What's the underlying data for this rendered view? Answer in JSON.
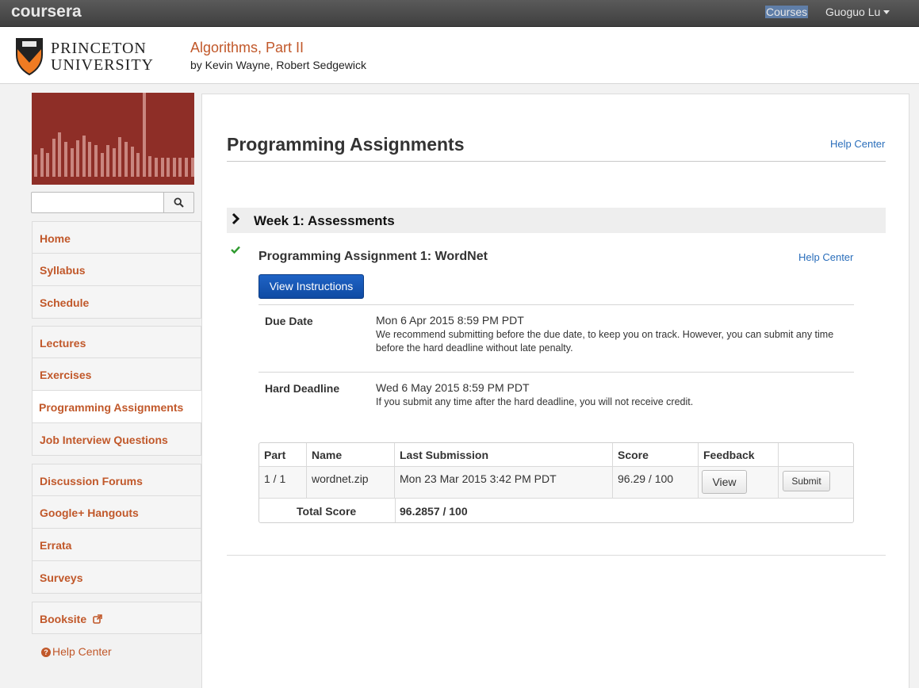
{
  "topbar": {
    "logo": "coursera",
    "courses_label": "Courses",
    "user_name": "Guoguo Lu"
  },
  "header": {
    "university_line1": "PRINCETON",
    "university_line2": "UNIVERSITY",
    "course_title": "Algorithms, Part II",
    "course_authors": "by Kevin Wayne, Robert Sedgewick"
  },
  "sidebar": {
    "group1": [
      "Home",
      "Syllabus",
      "Schedule"
    ],
    "group2": [
      "Lectures",
      "Exercises",
      "Programming Assignments",
      "Job Interview Questions"
    ],
    "group3": [
      "Discussion Forums",
      "Google+ Hangouts",
      "Errata",
      "Surveys"
    ],
    "group4": [
      "Booksite"
    ],
    "active_item": "Programming Assignments",
    "help_label": "Help Center"
  },
  "main": {
    "page_title": "Programming Assignments",
    "help_center_label": "Help Center",
    "week_title": "Week 1: Assessments",
    "assignment": {
      "title": "Programming Assignment 1: WordNet",
      "help_center_label": "Help Center",
      "view_instructions_label": "View Instructions",
      "due_date_label": "Due Date",
      "due_date_value": "Mon 6 Apr 2015 8:59 PM PDT",
      "due_date_note": "We recommend submitting before the due date, to keep you on track. However, you can submit any time before the hard deadline without late penalty.",
      "hard_deadline_label": "Hard Deadline",
      "hard_deadline_value": "Wed 6 May 2015 8:59 PM PDT",
      "hard_deadline_note": "If you submit any time after the hard deadline, you will not receive credit."
    },
    "table": {
      "headers": [
        "Part",
        "Name",
        "Last Submission",
        "Score",
        "Feedback"
      ],
      "row": {
        "part": "1 / 1",
        "name": "wordnet.zip",
        "last_submission": "Mon 23 Mar 2015 3:42 PM PDT",
        "score": "96.29 / 100",
        "feedback_button": "View",
        "submit_button": "Submit"
      },
      "total_label": "Total Score",
      "total_value": "96.2857 / 100"
    }
  }
}
